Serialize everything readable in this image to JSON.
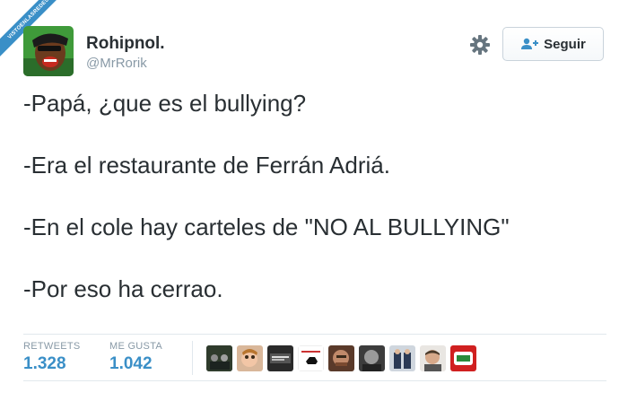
{
  "watermark": {
    "text": "VISTOENLASREDES"
  },
  "profile": {
    "display_name": "Rohipnol.",
    "handle": "@MrRorik",
    "avatar_icon": "avatar-cartoon-face"
  },
  "actions": {
    "settings_icon": "gear-icon",
    "follow_label": "Seguir",
    "follow_icon": "add-user-icon"
  },
  "tweet": {
    "lines": [
      "-Papá, ¿que es el bullying?",
      "-Era el restaurante de Ferrán Adriá.",
      "-En el cole hay carteles de \"NO AL BULLYING\"",
      "-Por eso ha cerrao."
    ]
  },
  "stats": {
    "retweets_label": "RETWEETS",
    "retweets_value": "1.328",
    "likes_label": "ME GUSTA",
    "likes_value": "1.042"
  },
  "likers_count_shown": 9,
  "colors": {
    "accent": "#3a8fc7",
    "text": "#292f33",
    "muted": "#8899a6",
    "border": "#e1e8ed"
  }
}
